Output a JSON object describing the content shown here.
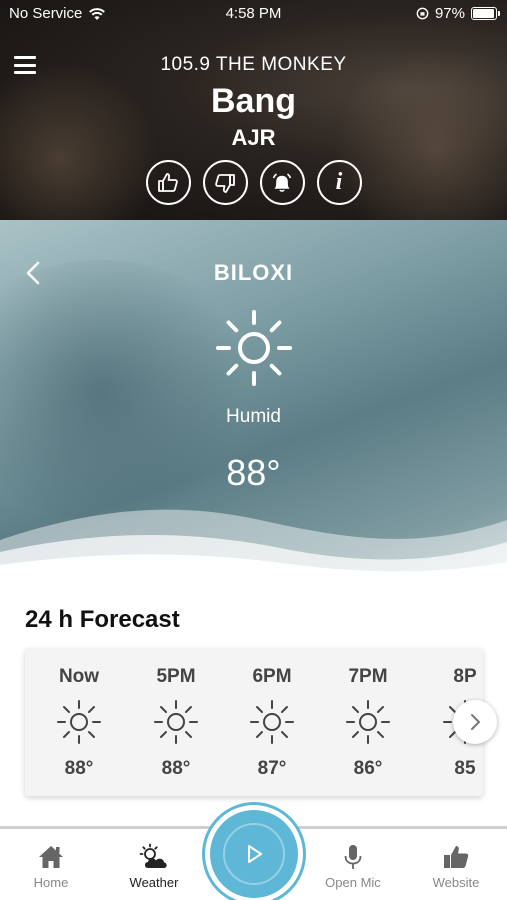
{
  "status_bar": {
    "carrier": "No Service",
    "time": "4:58 PM",
    "battery": "97%"
  },
  "now_playing": {
    "station": "105.9 THE MONKEY",
    "song": "Bang",
    "artist": "AJR",
    "info_glyph": "i"
  },
  "weather": {
    "city": "BILOXI",
    "condition": "Humid",
    "temperature": "88°"
  },
  "forecast": {
    "title": "24 h Forecast",
    "items": [
      {
        "time": "Now",
        "temp": "88°"
      },
      {
        "time": "5PM",
        "temp": "88°"
      },
      {
        "time": "6PM",
        "temp": "87°"
      },
      {
        "time": "7PM",
        "temp": "86°"
      },
      {
        "time": "8P",
        "temp": "85"
      }
    ]
  },
  "tabs": {
    "home": "Home",
    "weather": "Weather",
    "open_mic": "Open Mic",
    "website": "Website"
  },
  "colors": {
    "accent": "#5fb7d8"
  }
}
